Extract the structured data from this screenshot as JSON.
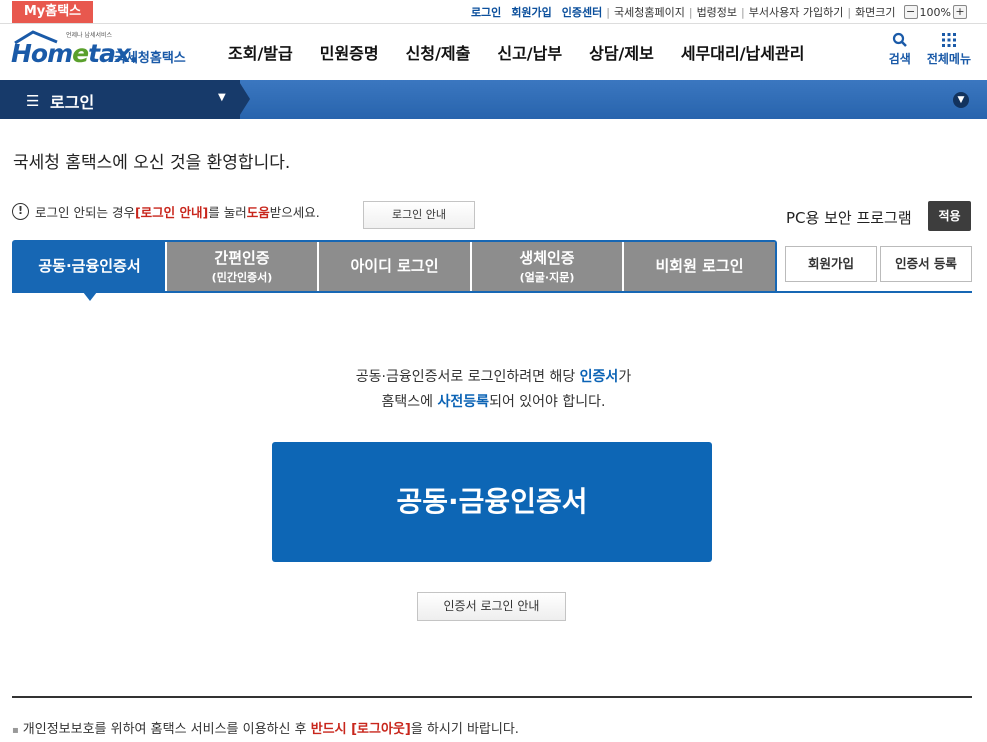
{
  "topbar": {
    "my_hometax": "My홈택스",
    "links": [
      "로그인",
      "회원가입",
      "인증센터"
    ],
    "sublinks": [
      "국세청홈페이지",
      "법령정보",
      "부서사용자 가입하기"
    ],
    "zoom_label": "화면크기",
    "zoom_minus": "−",
    "zoom_value": "100%",
    "zoom_plus": "+"
  },
  "header": {
    "logo_small": "언제나 납세서비스",
    "logo_home": "Hom",
    "logo_e": "e",
    "logo_tax": "tax.",
    "logo_sub": "국세청홈택스",
    "menu": [
      "조회/발급",
      "민원증명",
      "신청/제출",
      "신고/납부",
      "상담/제보",
      "세무대리/납세관리"
    ],
    "search_label": "검색",
    "allmenu_label": "전체메뉴"
  },
  "navbar": {
    "title": "로그인"
  },
  "welcome": "국세청 홈택스에 오신 것을 환영합니다.",
  "info": {
    "pre": "로그인 안되는 경우 ",
    "link1": "[로그인 안내]",
    "mid": "를 눌러 ",
    "link2": "도움",
    "post": "받으세요.",
    "button": "로그인 안내"
  },
  "security": {
    "label": "PC용 보안 프로그램",
    "apply": "적용"
  },
  "tabs": [
    {
      "label": "공동·금융인증서",
      "sub": ""
    },
    {
      "label": "간편인증",
      "sub": "(민간인증서)"
    },
    {
      "label": "아이디 로그인",
      "sub": ""
    },
    {
      "label": "생체인증",
      "sub": "(얼굴·지문)"
    },
    {
      "label": "비회원 로그인",
      "sub": ""
    }
  ],
  "side_buttons": {
    "join": "회원가입",
    "cert_register": "인증서 등록"
  },
  "description": {
    "line1_pre": "공동·금융인증서로 로그인하려면 해당 ",
    "line1_hl": "인증서",
    "line1_post": "가",
    "line2_pre": "홈택스에 ",
    "line2_hl": "사전등록",
    "line2_post": "되어 있어야 합니다."
  },
  "main_button": "공동·금융인증서",
  "cert_guide_button": "인증서 로그인 안내",
  "notice": {
    "bullet": "▪",
    "pre": "개인정보보호를 위하여 홈택스 서비스를 이용하신 후 ",
    "red": "반드시 [로그아웃]",
    "post": "을 하시기 바랍니다."
  },
  "colors": {
    "primary": "#1767b4",
    "nav_dark": "#173a6a",
    "tab_inactive": "#8d8d8d",
    "highlight_red": "#c8261c",
    "my_button": "#e8584e"
  }
}
